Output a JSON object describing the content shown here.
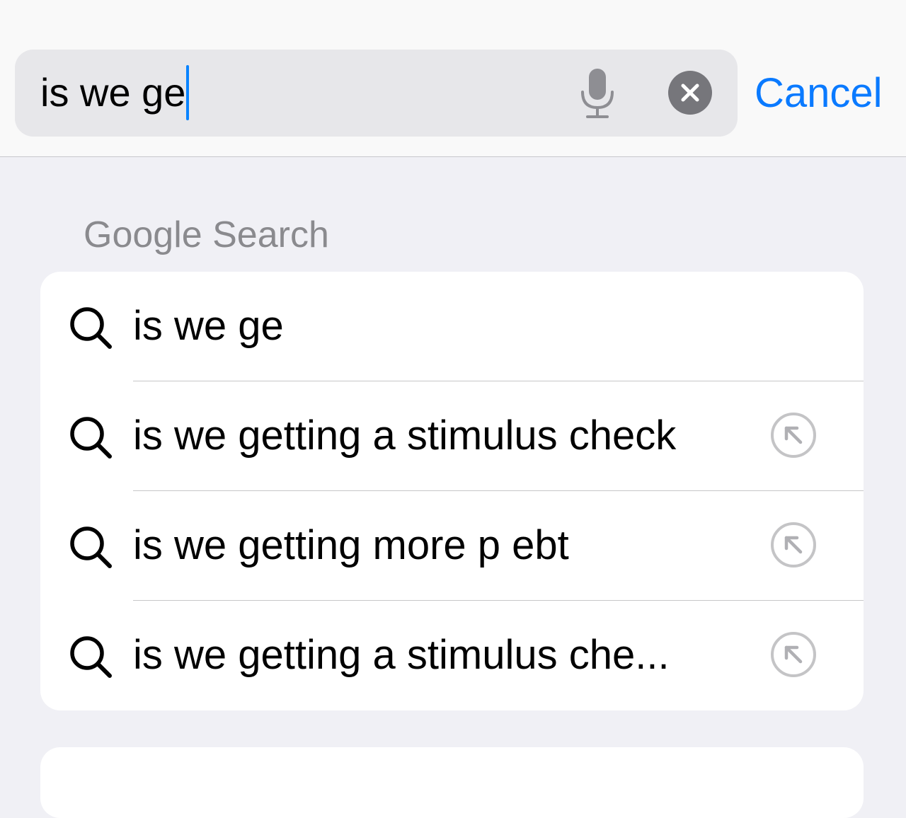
{
  "search": {
    "query": "is we ge",
    "cancel_label": "Cancel"
  },
  "section": {
    "title": "Google Search"
  },
  "suggestions": [
    {
      "text": "is we ge",
      "has_fill_arrow": false
    },
    {
      "text": "is we getting a stimulus check",
      "has_fill_arrow": true
    },
    {
      "text": "is we getting more p ebt",
      "has_fill_arrow": true
    },
    {
      "text": "is we getting a stimulus che...",
      "has_fill_arrow": true
    }
  ],
  "colors": {
    "accent": "#0a7aff",
    "caret": "#0a84ff",
    "secondary_text": "#8a8a8e"
  }
}
